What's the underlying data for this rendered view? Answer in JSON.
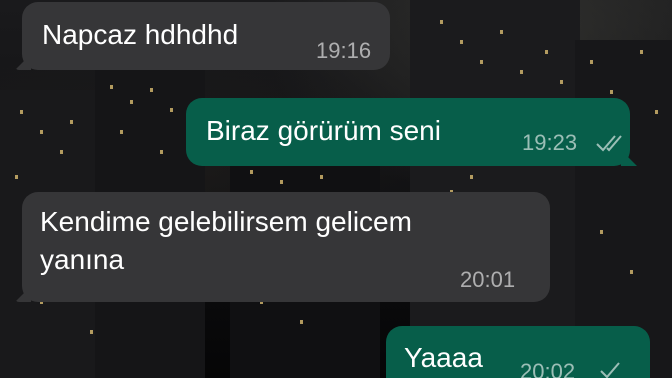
{
  "chat": {
    "messages": [
      {
        "direction": "incoming",
        "text": "Napcaz hdhdhd",
        "time": "19:16"
      },
      {
        "direction": "outgoing",
        "text": "Biraz görürüm seni",
        "time": "19:23",
        "status": "read-double-check-icon"
      },
      {
        "direction": "incoming",
        "text": "Kendime gelebilirsem gelicem\nyanına",
        "time": "20:01"
      },
      {
        "direction": "outgoing",
        "text": "Yaaaa",
        "time": "20:02",
        "status": "sent-check-icon"
      }
    ]
  },
  "colors": {
    "incoming_bubble": "#363638",
    "outgoing_bubble": "#075e4a",
    "text": "#ffffff",
    "timestamp": "rgba(255,255,255,0.6)"
  }
}
